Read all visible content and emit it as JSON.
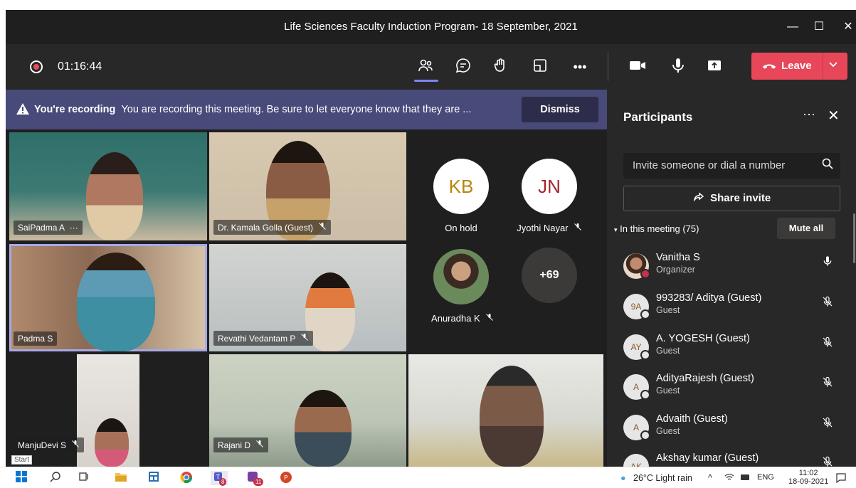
{
  "window": {
    "title": "Life Sciences Faculty Induction Program- 18 September, 2021",
    "minimize": "—",
    "maximize": "☐",
    "close": "✕"
  },
  "toolbar": {
    "timer": "01:16:44",
    "icons": {
      "participants": "participants-icon",
      "chat": "chat-icon",
      "react": "raise-hand-icon",
      "rooms": "breakout-rooms-icon",
      "more": "•••",
      "camera": "camera-icon",
      "mic": "microphone-icon",
      "share": "share-tray-icon"
    },
    "leave_label": "Leave"
  },
  "banner": {
    "bold": "You're recording",
    "text": "You are recording this meeting. Be sure to let everyone know that they are ...",
    "dismiss": "Dismiss"
  },
  "tiles": [
    {
      "name": "SaiPadma A",
      "extra": "···"
    },
    {
      "name": "Dr. Kamala Golla (Guest)",
      "muted": true
    },
    {
      "name": "Padma S"
    },
    {
      "name": "Revathi Vedantam P",
      "muted": true
    },
    {
      "name": "ManjuDevi S",
      "muted": true
    },
    {
      "name": "Rajani D",
      "muted": true
    },
    {
      "name": ""
    }
  ],
  "roster": {
    "kb": {
      "initials": "KB",
      "label": "On hold",
      "color": "#b8860b"
    },
    "jn": {
      "initials": "JN",
      "label": "Jyothi Nayar",
      "color": "#a4262c"
    },
    "ak": {
      "label": "Anuradha K"
    },
    "overflow": "+69"
  },
  "panel": {
    "title": "Participants",
    "more": "···",
    "close": "✕",
    "invite_placeholder": "Invite someone or dial a number",
    "share_invite": "Share invite",
    "in_meeting": "In this meeting (75)",
    "mute_all": "Mute all",
    "participants": [
      {
        "initials": "",
        "name": "Vanitha S",
        "role": "Organizer",
        "mic": "on"
      },
      {
        "initials": "9A",
        "name": "993283/ Aditya (Guest)",
        "role": "Guest",
        "mic": "muted"
      },
      {
        "initials": "AY",
        "name": "A. YOGESH (Guest)",
        "role": "Guest",
        "mic": "muted"
      },
      {
        "initials": "A",
        "name": "AdityaRajesh (Guest)",
        "role": "Guest",
        "mic": "muted"
      },
      {
        "initials": "A",
        "name": "Advaith (Guest)",
        "role": "Guest",
        "mic": "muted"
      },
      {
        "initials": "AK",
        "name": "Akshay kumar (Guest)",
        "role": "",
        "mic": "muted"
      }
    ]
  },
  "taskbar": {
    "start_tip": "Start",
    "weather": "26°C  Light rain",
    "lang": "ENG",
    "time": "11:02",
    "date": "18-09-2021",
    "badges": {
      "teams": "8",
      "app": "11"
    }
  }
}
